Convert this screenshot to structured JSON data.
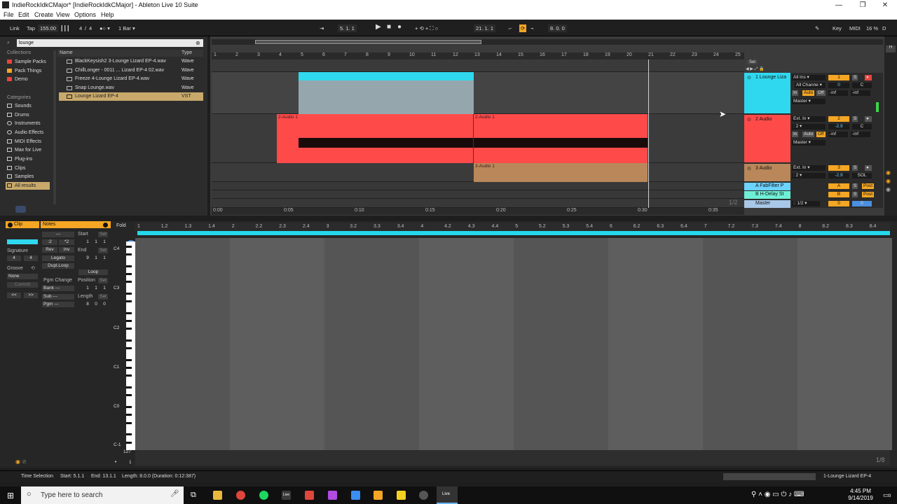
{
  "window": {
    "title": "IndieRockIdkCMajor* [IndieRockIdkCMajor] - Ableton Live 10 Suite",
    "min": "—",
    "max": "❐",
    "close": "✕"
  },
  "menu": [
    "File",
    "Edit",
    "Create",
    "View",
    "Options",
    "Help"
  ],
  "control": {
    "link": "Link",
    "tap": "Tap",
    "tempo": "155.00",
    "sig_num": "4",
    "sig_den": "4",
    "quant": "1 Bar",
    "position": "5.   1.   1",
    "loop_start": "21.   1.   1",
    "loop_len": "8.   0.   0",
    "key": "Key",
    "midi": "MIDI",
    "cpu": "16 %",
    "d": "D"
  },
  "browser": {
    "search_value": "lounge",
    "collections_title": "Collections",
    "collections": [
      {
        "label": "Sample Packs",
        "color": "#e8443c"
      },
      {
        "label": "Pack Things",
        "color": "#f5a623"
      },
      {
        "label": "Demo",
        "color": "#e8443c"
      }
    ],
    "categories_title": "Categories",
    "categories": [
      "Sounds",
      "Drums",
      "Instruments",
      "Audio Effects",
      "MIDI Effects",
      "Max for Live",
      "Plug-ins",
      "Clips",
      "Samples",
      "All results"
    ],
    "col_name": "Name",
    "col_type": "Type",
    "files": [
      {
        "name": "BlackKeysish2 3-Lounge Lizard EP-4.wav",
        "type": "Wave"
      },
      {
        "name": "ChillLonger - 0011 ... Lizard EP-4 02.wav",
        "type": "Wave"
      },
      {
        "name": "Freeze 4-Lounge Lizard EP-4.wav",
        "type": "Wave"
      },
      {
        "name": "Snap Lounge.wav",
        "type": "Wave"
      },
      {
        "name": "Lounge Lizard EP-4",
        "type": "VST"
      }
    ]
  },
  "arrangement": {
    "bars": [
      "1",
      "2",
      "3",
      "4",
      "5",
      "6",
      "7",
      "8",
      "9",
      "10",
      "11",
      "12",
      "13",
      "14",
      "15",
      "16",
      "17",
      "18",
      "19",
      "20",
      "21",
      "22",
      "23",
      "24",
      "25"
    ],
    "times": [
      "0:00",
      "0:05",
      "0:10",
      "0:15",
      "0:20",
      "0:25",
      "0:30",
      "0:35"
    ],
    "set_label": "Set",
    "zoom": "1/2",
    "clips": {
      "audio1": "2-Audio 1",
      "audio2": "2-Audio 1",
      "audio3": "3-Audio 1"
    }
  },
  "mixer": {
    "tracks": [
      {
        "name": "1 Lounge Liza",
        "input": "All Ins",
        "channel": "All Channe",
        "out": "Master",
        "num": "1",
        "vol": "0",
        "pan": "C",
        "in": "In",
        "auto": "Auto",
        "off": "Off",
        "inf1": "-inf",
        "inf2": "-inf",
        "color": "#2fd8ef"
      },
      {
        "name": "2 Audio",
        "input": "Ext. In",
        "channel": "2",
        "out": "Master",
        "num": "2",
        "vol": "-2.9",
        "pan": "C",
        "in": "In",
        "auto": "Auto",
        "off": "Off",
        "inf1": "-inf",
        "inf2": "-inf",
        "color": "#ff4a4a"
      },
      {
        "name": "3 Audio",
        "input": "Ext. In",
        "channel": "2",
        "num": "3",
        "vol": "-2.9",
        "pan": "SOL",
        "color": "#b9875a"
      }
    ],
    "returns": [
      {
        "name": "A FabFilter P",
        "letter": "A",
        "post": "Post"
      },
      {
        "name": "B H-Delay St",
        "letter": "B",
        "post": "Post"
      }
    ],
    "master": {
      "name": "Master",
      "fraction": "1/2",
      "vol": "0",
      "pan": "0"
    },
    "s_label": "S"
  },
  "clip": {
    "clip_title": "Clip",
    "notes_title": "Notes",
    "fold": "Fold",
    "signature_label": "Signature",
    "sig_num": "4",
    "sig_den": "4",
    "groove_label": "Groove",
    "groove_value": "None",
    "commit": "Commit",
    "div2": ":2",
    "mul2": "*2",
    "rev": "Rev",
    "inv": "Inv",
    "legato": "Legato",
    "dupl": "Dupl.Loop",
    "start_label": "Start",
    "start_val": [
      "1",
      "1",
      "1"
    ],
    "end_label": "End",
    "end_val": [
      "9",
      "1",
      "1"
    ],
    "set": "Set",
    "loop": "Loop",
    "pgm_change": "Pgm Change",
    "bank": "Bank ---",
    "sub": "Sub ---",
    "pgm": "Pgm ---",
    "position_label": "Position",
    "position_val": [
      "1",
      "1",
      "1"
    ],
    "length_label": "Length",
    "length_val": [
      "8",
      "0",
      "0"
    ],
    "dashes": "---",
    "nav_left": "<<",
    "nav_right": ">>",
    "ruler": [
      "1",
      "1.2",
      "1.3",
      "1.4",
      "2",
      "2.2",
      "2.3",
      "2.4",
      "3",
      "3.2",
      "3.3",
      "3.4",
      "4",
      "4.2",
      "4.3",
      "4.4",
      "5",
      "5.2",
      "5.3",
      "5.4",
      "6",
      "6.2",
      "6.3",
      "6.4",
      "7",
      "7.2",
      "7.3",
      "7.4",
      "8",
      "8.2",
      "8.3",
      "8.4"
    ],
    "keys": [
      "C4",
      "C3",
      "C2",
      "C1",
      "C0",
      "C-1"
    ],
    "vel_top": "127",
    "vel_bot": "1",
    "grid": "1/8"
  },
  "status": {
    "text": "Time Selection",
    "start": "Start: 5.1.1",
    "end": "End: 13.1.1",
    "length": "Length: 8.0.0  (Duration: 0:12:387)",
    "track": "1-Lounge Lizard EP-4"
  },
  "taskbar": {
    "search_placeholder": "Type here to search",
    "time": "4:45 PM",
    "date": "9/14/2019",
    "notif": "3",
    "live1": "Live",
    "live2": "Live"
  }
}
